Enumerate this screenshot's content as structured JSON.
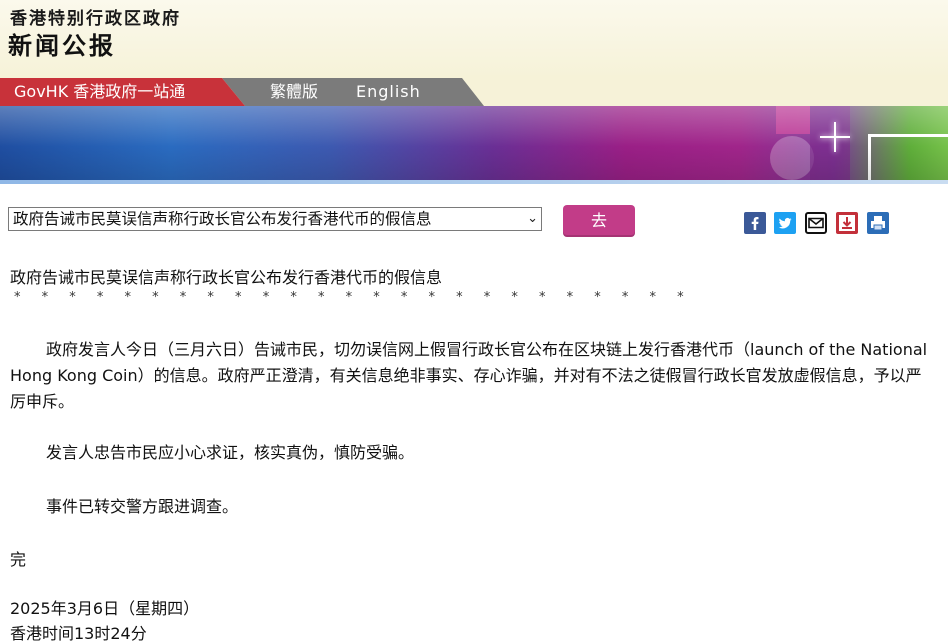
{
  "header": {
    "agency": "香港特别行政区政府",
    "site_title": "新闻公报"
  },
  "nav": {
    "govhk": "GovHK 香港政府一站通",
    "traditional": "繁體版",
    "english": "English"
  },
  "toolbar": {
    "select_value": "政府告诫市民莫误信声称行政长官公布发行香港代币的假信息",
    "go_label": "去",
    "share_icons": [
      "facebook-icon",
      "twitter-icon",
      "email-icon",
      "download-icon",
      "print-icon"
    ]
  },
  "article": {
    "title": "政府告诫市民莫误信声称行政长官公布发行香港代币的假信息",
    "separator": "* * * * * * * * * * * * * * * * * * * * * * * * *",
    "para1": "政府发言人今日（三月六日）告诫市民，切勿误信网上假冒行政长官公布在区块链上发行香港代币（launch of the National Hong Kong Coin）的信息。政府严正澄清，有关信息绝非事实、存心诈骗，并对有不法之徒假冒行政长官发放虚假信息，予以严厉申斥。",
    "para2": "发言人忠告市民应小心求证，核实真伪，慎防受骗。",
    "para3": "事件已转交警方跟进调查。",
    "end": "完",
    "date": "2025年3月6日（星期四）",
    "time": "香港时间13时24分"
  },
  "colors": {
    "govhk_red": "#c8323a",
    "go_button": "#c23c88",
    "header_bg": "#f6f2d8"
  }
}
